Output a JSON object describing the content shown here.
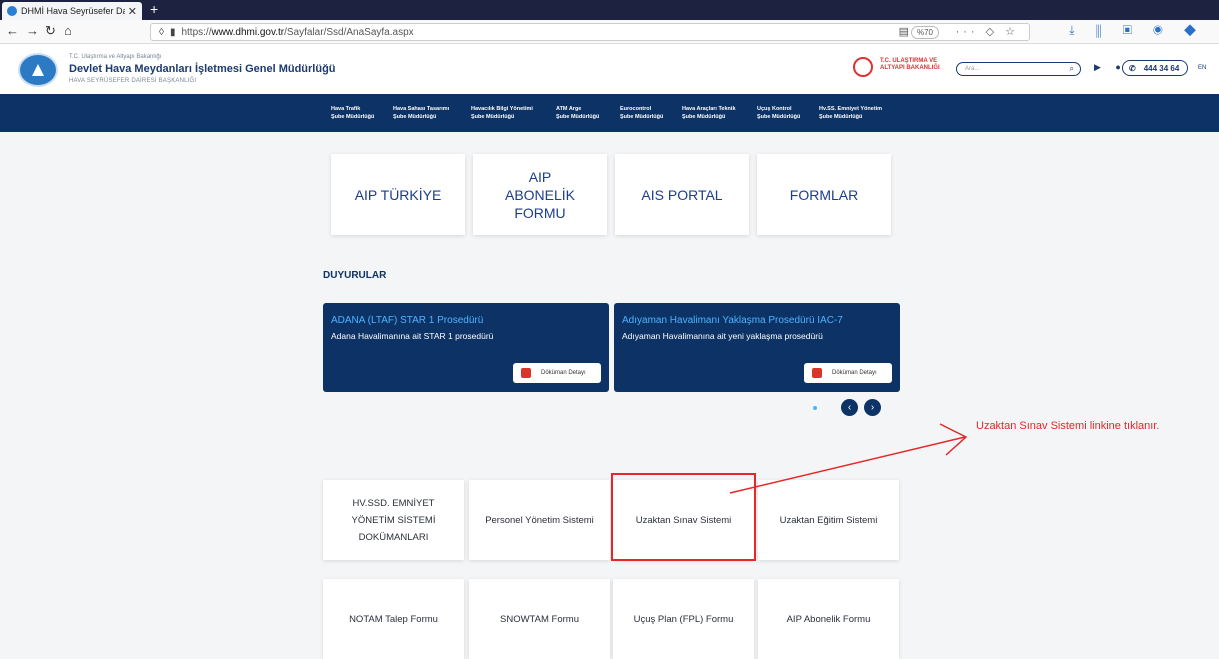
{
  "browser": {
    "tab_title": "DHMİ Hava Seyrüsefer Dairesi B...",
    "tab_close": "✕",
    "new_tab": "+",
    "url_host": "www.dhmi.gov.tr",
    "url_prefix": "https://",
    "url_path": "/Sayfalar/Ssd/AnaSayfa.aspx",
    "zoom": "%70"
  },
  "header": {
    "ministry": "T.C. Ulaştırma ve Altyapı Bakanlığı",
    "org_name": "Devlet Hava Meydanları İşletmesi Genel Müdürlüğü",
    "dept": "HAVA SEYRÜSEFER DAİRESİ BAŞKANLIĞI",
    "ministry_logo_text": "T.C. ULAŞTIRMA VE ALTYAPI BAKANLIĞI",
    "search_placeholder": "Ara...",
    "phone": "444 34 64",
    "lang": "EN"
  },
  "nav": [
    {
      "line1": "Hava Trafik",
      "line2": "Şube Müdürlüğü"
    },
    {
      "line1": "Hava Sahası Tasarımı",
      "line2": "Şube Müdürlüğü"
    },
    {
      "line1": "Havacılık Bilgi Yönetimi",
      "line2": "Şube Müdürlüğü"
    },
    {
      "line1": "ATM Arge",
      "line2": "Şube Müdürlüğü"
    },
    {
      "line1": "Eurocontrol",
      "line2": "Şube Müdürlüğü"
    },
    {
      "line1": "Hava Araçları Teknik",
      "line2": "Şube Müdürlüğü"
    },
    {
      "line1": "Uçuş Kontrol",
      "line2": "Şube Müdürlüğü"
    },
    {
      "line1": "Hv.SS. Emniyet Yönetim",
      "line2": "Şube Müdürlüğü"
    }
  ],
  "top_cards": [
    "AIP TÜRKİYE",
    "AIP ABONELİK FORMU",
    "AIS PORTAL",
    "FORMLAR"
  ],
  "announcements": {
    "title": "DUYURULAR",
    "items": [
      {
        "title": "ADANA (LTAF) STAR 1 Prosedürü",
        "desc": "Adana Havalimanına ait STAR 1 prosedürü",
        "button": "Döküman Detayı"
      },
      {
        "title": "Adıyaman Havalimanı Yaklaşma Prosedürü IAC-7",
        "desc": "Adıyaman Havalimanına ait yeni yaklaşma prosedürü",
        "button": "Döküman Detayı"
      }
    ],
    "prev": "‹",
    "next": "›"
  },
  "bottom_cards_row1": [
    "HV.SSD. EMNİYET YÖNETİM SİSTEMİ DOKÜMANLARI",
    "Personel Yönetim Sistemi",
    "Uzaktan Sınav Sistemi",
    "Uzaktan Eğitim Sistemi"
  ],
  "bottom_cards_row2": [
    "NOTAM Talep Formu",
    "SNOWTAM Formu",
    "Uçuş Plan (FPL) Formu",
    "AIP Abonelik Formu"
  ],
  "annotation": {
    "text": "Uzaktan Sınav Sistemi linkine tıklanır.",
    "color": "#e52727"
  },
  "colors": {
    "navy": "#0d3366",
    "accent_blue": "#4cb3ff",
    "card_text": "#1c3e8a"
  }
}
